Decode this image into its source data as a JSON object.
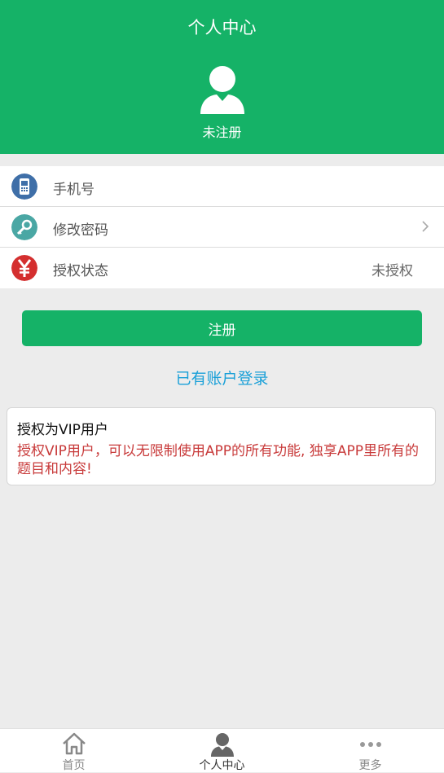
{
  "header": {
    "title": "个人中心",
    "user_status": "未注册"
  },
  "menu": [
    {
      "label": "手机号",
      "icon": "phone-icon",
      "value": ""
    },
    {
      "label": "修改密码",
      "icon": "key-icon",
      "value": ""
    },
    {
      "label": "授权状态",
      "icon": "yen-icon",
      "value": "未授权"
    }
  ],
  "register_button": "注册",
  "login_link": "已有账户登录",
  "vip_card": {
    "title": "授权为VIP用户",
    "description": "授权VIP用户，可以无限制使用APP的所有功能, 独享APP里所有的题目和内容!"
  },
  "tabbar": [
    {
      "label": "首页",
      "icon": "home-icon"
    },
    {
      "label": "个人中心",
      "icon": "user-icon",
      "active": true
    },
    {
      "label": "更多",
      "icon": "more-icon"
    }
  ],
  "colors": {
    "brand_green": "#15b267",
    "link_blue": "#1aa0d8",
    "warning_red": "#c83a3a"
  }
}
